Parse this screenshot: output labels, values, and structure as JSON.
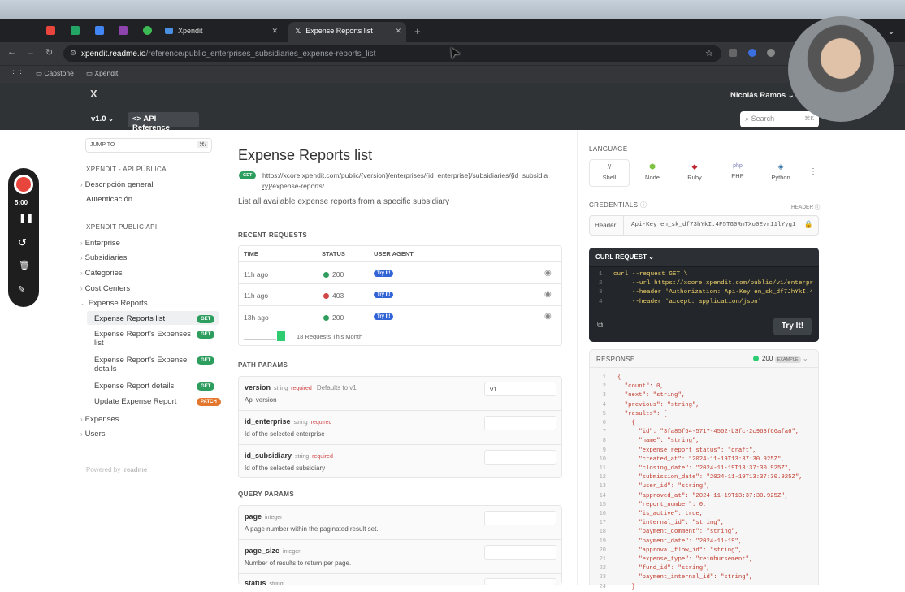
{
  "browser": {
    "tabs": [
      {
        "label": "Xpendit"
      },
      {
        "label": "Expense Reports list"
      }
    ],
    "new_tab": "+",
    "url_domain": "xpendit.readme.io",
    "url_path": "/reference/public_enterprises_subsidiaries_expense-reports_list",
    "bookmarks": [
      "Capstone",
      "Xpendit"
    ]
  },
  "header": {
    "logo": "X",
    "user": "Nicolás Ramos",
    "version": "v1.0",
    "api_reference": "API Reference",
    "search_placeholder": "Search",
    "search_shortcut": "⌘K"
  },
  "recorder": {
    "timer": "5:00"
  },
  "sidebar": {
    "jump_to": "JUMP TO",
    "jump_shortcut": "⌘/",
    "section1": "XPENDIT - API PÚBLICA",
    "items1": [
      "Descripción general",
      "Autenticación"
    ],
    "section2": "XPENDIT PUBLIC API",
    "items2": [
      "Enterprise",
      "Subsidiaries",
      "Categories",
      "Cost Centers",
      "Expense Reports"
    ],
    "sub": [
      {
        "label": "Expense Reports list",
        "badge": "GET"
      },
      {
        "label": "Expense Report's Expenses",
        "label2": "list",
        "badge": "GET"
      },
      {
        "label": "Expense Report's Expense",
        "label2": "details",
        "badge": "GET"
      },
      {
        "label": "Expense Report details",
        "badge": "GET"
      },
      {
        "label": "Update Expense Report",
        "badge": "PATCH"
      }
    ],
    "items3": [
      "Expenses",
      "Users"
    ],
    "powered": "Powered by",
    "powered_brand": "readme"
  },
  "main": {
    "title": "Expense Reports list",
    "method": "GET",
    "endpoint_prefix": "https://xcore.xpendit.com/public/",
    "endpoint_version": "{version}",
    "endpoint_mid1": "/enterprises/",
    "endpoint_ent": "{id_enterprise}",
    "endpoint_mid2": "/subsidiaries/",
    "endpoint_sub": "{id_subsidia",
    "endpoint_line2a": "ry}",
    "endpoint_line2b": "/expense-reports/",
    "description": "List all available expense reports from a specific subsidiary",
    "recent_title": "RECENT REQUESTS",
    "col_time": "TIME",
    "col_status": "STATUS",
    "col_agent": "USER AGENT",
    "requests": [
      {
        "time": "11h ago",
        "status": "200",
        "color": "#2e9e5f",
        "agent": "Try It!"
      },
      {
        "time": "11h ago",
        "status": "403",
        "color": "#d04545",
        "agent": "Try It!"
      },
      {
        "time": "13h ago",
        "status": "200",
        "color": "#2e9e5f",
        "agent": "Try It!"
      }
    ],
    "month_summary": "18 Requests This Month",
    "path_title": "PATH PARAMS",
    "path_params": [
      {
        "name": "version",
        "type": "string",
        "req": "required",
        "default": "Defaults to v1",
        "desc": "Api version",
        "value": "v1"
      },
      {
        "name": "id_enterprise",
        "type": "string",
        "req": "required",
        "desc": "Id of the selected enterprise",
        "value": ""
      },
      {
        "name": "id_subsidiary",
        "type": "string",
        "req": "required",
        "desc": "Id of the selected subsidiary",
        "value": ""
      }
    ],
    "query_title": "QUERY PARAMS",
    "query_params": [
      {
        "name": "page",
        "type": "integer",
        "desc": "A page number within the paginated result set."
      },
      {
        "name": "page_size",
        "type": "integer",
        "desc": "Number of results to return per page."
      },
      {
        "name": "status",
        "type": "string"
      }
    ]
  },
  "right": {
    "language_title": "LANGUAGE",
    "languages": [
      "Shell",
      "Node",
      "Ruby",
      "PHP",
      "Python"
    ],
    "credentials_title": "CREDENTIALS",
    "header_label": "HEADER",
    "cred_field": "Header",
    "cred_value": "Api-Key en_sk_df73hYkI.4F5TG0RmTXo0Evr11lYyg1",
    "curl_title": "CURL REQUEST",
    "curl_lines": [
      {
        "n": "1",
        "text": "curl --request GET \\"
      },
      {
        "n": "2",
        "text": "     --url https://xcore.xpendit.com/public/v1/enterpr"
      },
      {
        "n": "3",
        "text": "     --header 'Authorization: Api-Key en_sk_df7JhYkI.4"
      },
      {
        "n": "4",
        "text": "     --header 'accept: application/json'"
      }
    ],
    "try_it": "Try It!",
    "response_title": "RESPONSE",
    "response_status": "200",
    "response_example": "EXAMPLE",
    "response_lines": [
      "{",
      "  \"count\": 0,",
      "  \"next\": \"string\",",
      "  \"previous\": \"string\",",
      "  \"results\": [",
      "    {",
      "      \"id\": \"3fa85f64-5717-4562-b3fc-2c963f66afa6\",",
      "      \"name\": \"string\",",
      "      \"expense_report_status\": \"draft\",",
      "      \"created_at\": \"2024-11-19T13:37:30.925Z\",",
      "      \"closing_date\": \"2024-11-19T13:37:30.925Z\",",
      "      \"submission_date\": \"2024-11-19T13:37:30.925Z\",",
      "      \"user_id\": \"string\",",
      "      \"approved_at\": \"2024-11-19T13:37:30.925Z\",",
      "      \"report_number\": 0,",
      "      \"is_active\": true,",
      "      \"internal_id\": \"string\",",
      "      \"payment_comment\": \"string\",",
      "      \"payment_date\": \"2024-11-19\",",
      "      \"approval_flow_id\": \"string\",",
      "      \"expense_type\": \"reimbursement\",",
      "      \"fund_id\": \"string\",",
      "      \"payment_internal_id\": \"string\",",
      "    }"
    ]
  }
}
